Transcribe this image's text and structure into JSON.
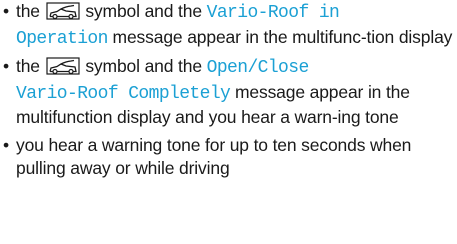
{
  "colors": {
    "text": "#1a1a1a",
    "highlight": "#1ba0d4"
  },
  "items": [
    {
      "bullet": "•",
      "pre": "the",
      "icon": "convertible-roof-icon",
      "mid": "symbol and the",
      "message_line1": "Vario-Roof in",
      "message_line2": "Operation",
      "post": "message appear in the multifunc-tion display"
    },
    {
      "bullet": "•",
      "pre": "the",
      "icon": "convertible-roof-icon",
      "mid": "symbol and the",
      "message_line1": "Open/Close",
      "message_line2": "Vario-Roof Completely",
      "post": "message appear in the multifunction display and you hear a warn-ing tone"
    },
    {
      "bullet": "•",
      "text": "you hear a warning tone for up to ten seconds when pulling away or while driving"
    }
  ]
}
